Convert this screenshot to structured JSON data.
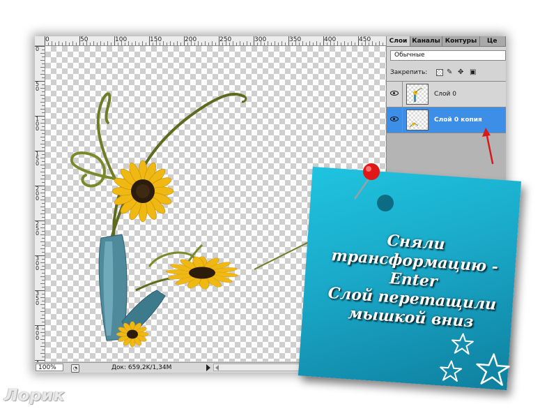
{
  "ruler": {
    "h_labels": [
      "0",
      "50",
      "100",
      "150",
      "200",
      "250",
      "300",
      "350",
      "400",
      "450"
    ],
    "v_labels": [
      "0",
      "50",
      "100",
      "150",
      "200",
      "250",
      "300",
      "350",
      "400",
      "450"
    ]
  },
  "status_bar": {
    "zoom": "100%",
    "doc_info": "Док: 659,2K/1,34M"
  },
  "panel": {
    "tabs": [
      "Слои",
      "Каналы",
      "Контуры",
      "Це"
    ],
    "active_tab": "Слои",
    "blend_mode": "Обычные",
    "lock_label": "Закрепить:",
    "layers": [
      {
        "name": "Слой 0",
        "visible": true,
        "selected": false
      },
      {
        "name": "Слой 0 копия",
        "visible": true,
        "selected": true
      }
    ]
  },
  "note": {
    "lines": [
      "Сняли",
      "трансформацию -",
      "Enter",
      "Слой перетащили",
      "мышкой вниз"
    ]
  },
  "watermark": "Лорик",
  "colors": {
    "selected_layer": "#3d8ee6",
    "note_teal": "#1aa8c8",
    "arrow_red": "#d41a1a"
  }
}
